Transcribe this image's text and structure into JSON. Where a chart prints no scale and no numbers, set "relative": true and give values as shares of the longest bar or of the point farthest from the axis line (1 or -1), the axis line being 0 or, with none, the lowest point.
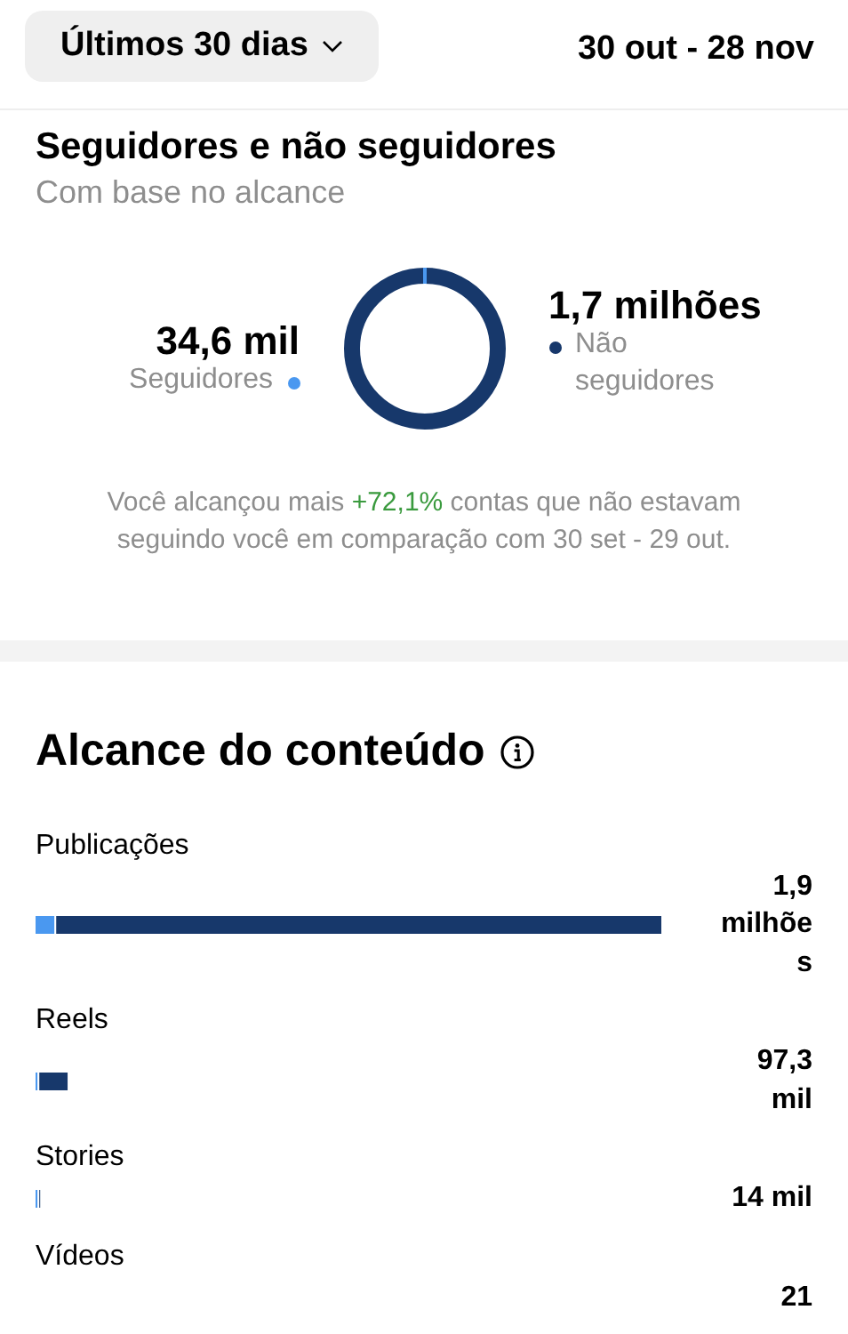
{
  "header": {
    "period_button": "Últimos 30 dias",
    "date_range": "30 out - 28 nov"
  },
  "audience": {
    "title": "Seguidores e não seguidores",
    "subtitle": "Com base no alcance",
    "legend": [
      {
        "value": "34,6 mil",
        "label": "Seguidores",
        "color": "#4a98f0"
      },
      {
        "value": "1,7 milhões",
        "label": "Não seguidores",
        "color": "#17386b"
      }
    ],
    "note": {
      "before": "Você alcançou mais ",
      "highlight": "+72,1%",
      "after": " contas que não estavam seguindo você em comparação com 30 set - 29 out."
    }
  },
  "content_reach": {
    "title": "Alcance do conteúdo",
    "chart_data": {
      "type": "bar",
      "orientation": "horizontal",
      "relative": true,
      "categories": [
        "Publicações",
        "Reels",
        "Stories",
        "Vídeos"
      ],
      "values": [
        1,
        0.0512,
        0.0074,
        1e-05
      ]
    },
    "reach_totals": [
      "1,9 milhões",
      "97,3 mil",
      "14 mil",
      "21"
    ]
  }
}
